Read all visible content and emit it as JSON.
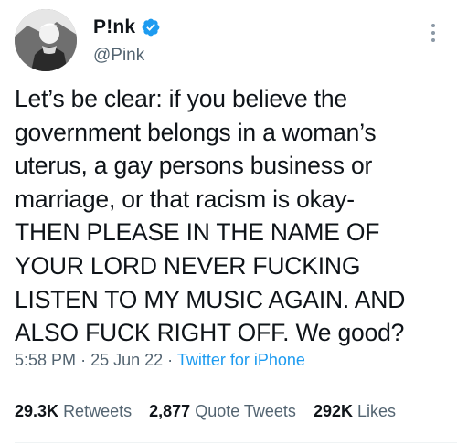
{
  "author": {
    "display_name": "P!nk",
    "handle": "@Pink",
    "verified_icon": "verified-badge-icon",
    "avatar": "profile-photo"
  },
  "tweet": {
    "text": "Let’s be clear: if you believe the\ngovernment belongs in a woman’s\nuterus, a gay persons business or\nmarriage, or that racism is okay-\nTHEN PLEASE IN THE NAME OF\nYOUR LORD NEVER FUCKING\nLISTEN TO MY MUSIC AGAIN. AND\nALSO FUCK RIGHT OFF. We good?",
    "time": "5:58 PM",
    "separator": "·",
    "date": "25 Jun 22",
    "source": "Twitter for iPhone"
  },
  "stats": {
    "retweets": {
      "count": "29.3K",
      "label": "Retweets"
    },
    "quote_tweets": {
      "count": "2,877",
      "label": "Quote Tweets"
    },
    "likes": {
      "count": "292K",
      "label": "Likes"
    }
  },
  "colors": {
    "text": "#0f1419",
    "secondary": "#536471",
    "accent": "#1d9bf0",
    "divider": "#eff3f4"
  }
}
